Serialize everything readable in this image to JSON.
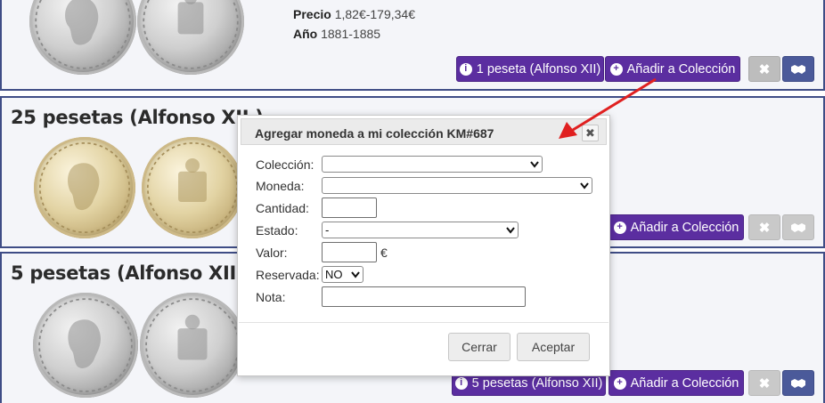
{
  "top_card": {
    "price_label": "Precio",
    "price_value": "1,82€-179,34€",
    "year_label": "Año",
    "year_value": "1881-1885",
    "info_button": "1 peseta (Alfonso XII)",
    "add_button": "Añadir a Colección"
  },
  "mid_card": {
    "title": "25 pesetas (Alfonso XII )",
    "add_button": "Añadir a Colección"
  },
  "bot_card": {
    "title": "5 pesetas (Alfonso XII)",
    "info_button": "5 pesetas (Alfonso XII)",
    "add_button": "Añadir a Colección"
  },
  "modal": {
    "title": "Agregar moneda a mi colección KM#687",
    "fields": {
      "coleccion_label": "Colección:",
      "moneda_label": "Moneda:",
      "cantidad_label": "Cantidad:",
      "estado_label": "Estado:",
      "estado_value": "-",
      "valor_label": "Valor:",
      "valor_unit": "€",
      "reservada_label": "Reservada:",
      "reservada_value": "NO",
      "nota_label": "Nota:"
    },
    "cancel_button": "Cerrar",
    "accept_button": "Aceptar",
    "close_icon": "✖"
  },
  "icons": {
    "info": "info-circle-icon",
    "plus": "plus-circle-icon",
    "remove": "times-icon",
    "trade": "handshake-icon",
    "close": "close-icon",
    "dropdown": "chevron-down-icon"
  },
  "colors": {
    "primary_purple": "#5b2ea0",
    "navy": "#4b5a9a",
    "grey_button": "#bdbdbd",
    "annotation_red": "#e02020",
    "card_border": "#3f4d86"
  }
}
